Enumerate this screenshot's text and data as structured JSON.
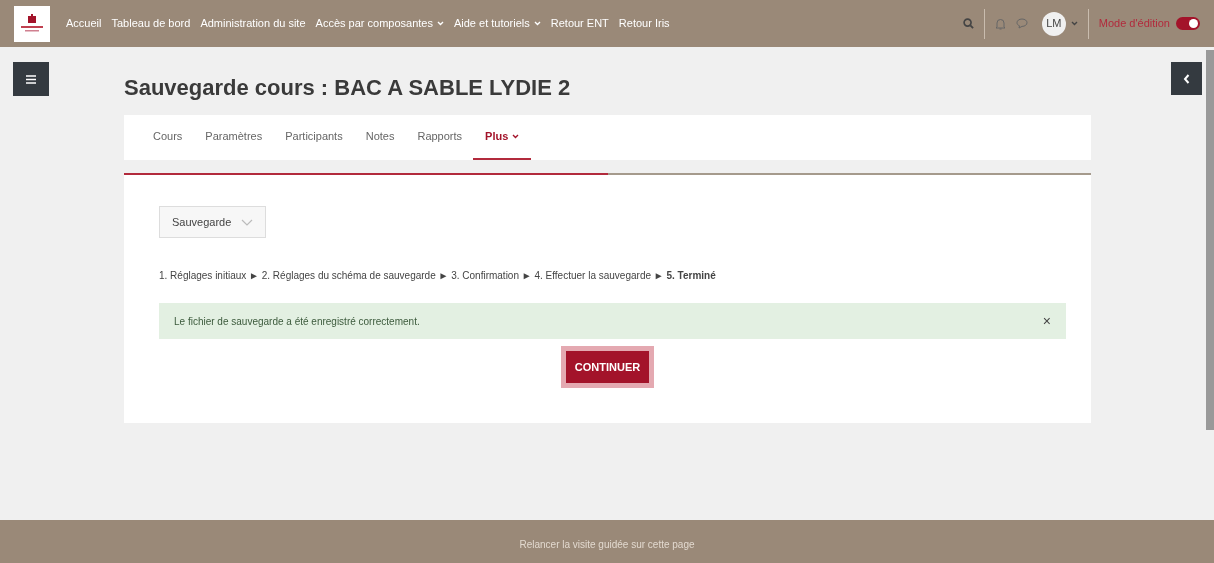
{
  "nav": [
    {
      "label": "Accueil",
      "dropdown": false
    },
    {
      "label": "Tableau de bord",
      "dropdown": false
    },
    {
      "label": "Administration du site",
      "dropdown": false
    },
    {
      "label": "Accès par composantes",
      "dropdown": true
    },
    {
      "label": "Aide et tutoriels",
      "dropdown": true
    },
    {
      "label": "Retour ENT",
      "dropdown": false
    },
    {
      "label": "Retour Iris",
      "dropdown": false
    }
  ],
  "user": {
    "initials": "LM"
  },
  "edit_mode": {
    "label": "Mode d'édition",
    "on": true
  },
  "page_title": "Sauvegarde cours : BAC A SABLE LYDIE 2",
  "tabs": [
    {
      "label": "Cours",
      "selected": false,
      "dropdown": false
    },
    {
      "label": "Paramètres",
      "selected": false,
      "dropdown": false
    },
    {
      "label": "Participants",
      "selected": false,
      "dropdown": false
    },
    {
      "label": "Notes",
      "selected": false,
      "dropdown": false
    },
    {
      "label": "Rapports",
      "selected": false,
      "dropdown": false
    },
    {
      "label": "Plus",
      "selected": true,
      "dropdown": true
    }
  ],
  "progress": {
    "level": 0.5
  },
  "select": {
    "value": "Sauvegarde"
  },
  "steps": "1. Réglages initiaux ► 2. Réglages du schéma de sauvegarde ► 3. Confirmation ► 4. Effectuer la sauvegarde ► **5. Terminé**",
  "alert": {
    "message": "Le fichier de sauvegarde a été enregistré correctement.",
    "close": "×"
  },
  "continue_button": "CONTINUER",
  "footer": {
    "tour_link": "Relancer la visite guidée sur cette page"
  }
}
